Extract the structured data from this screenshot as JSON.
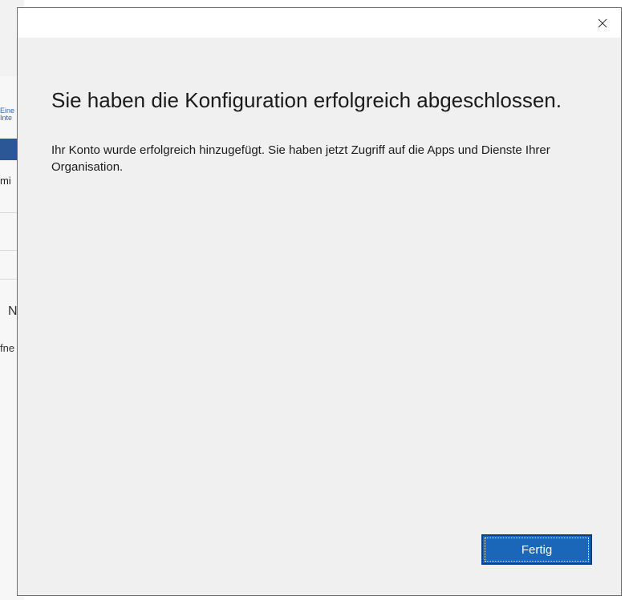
{
  "background": {
    "link_text": "Eine\nInte",
    "label_1": "mi",
    "label_2": "N",
    "label_3": "fne"
  },
  "dialog": {
    "heading": "Sie haben die Konfiguration erfolgreich abgeschlossen.",
    "body": "Ihr Konto wurde erfolgreich hinzugefügt. Sie haben jetzt Zugriff auf die Apps und Dienste Ihrer Organisation.",
    "done_button": "Fertig",
    "close_icon": "close-icon"
  },
  "colors": {
    "accent": "#1a66b8",
    "dialog_bg": "#f0f0f0",
    "titlebar_bg": "#ffffff"
  }
}
